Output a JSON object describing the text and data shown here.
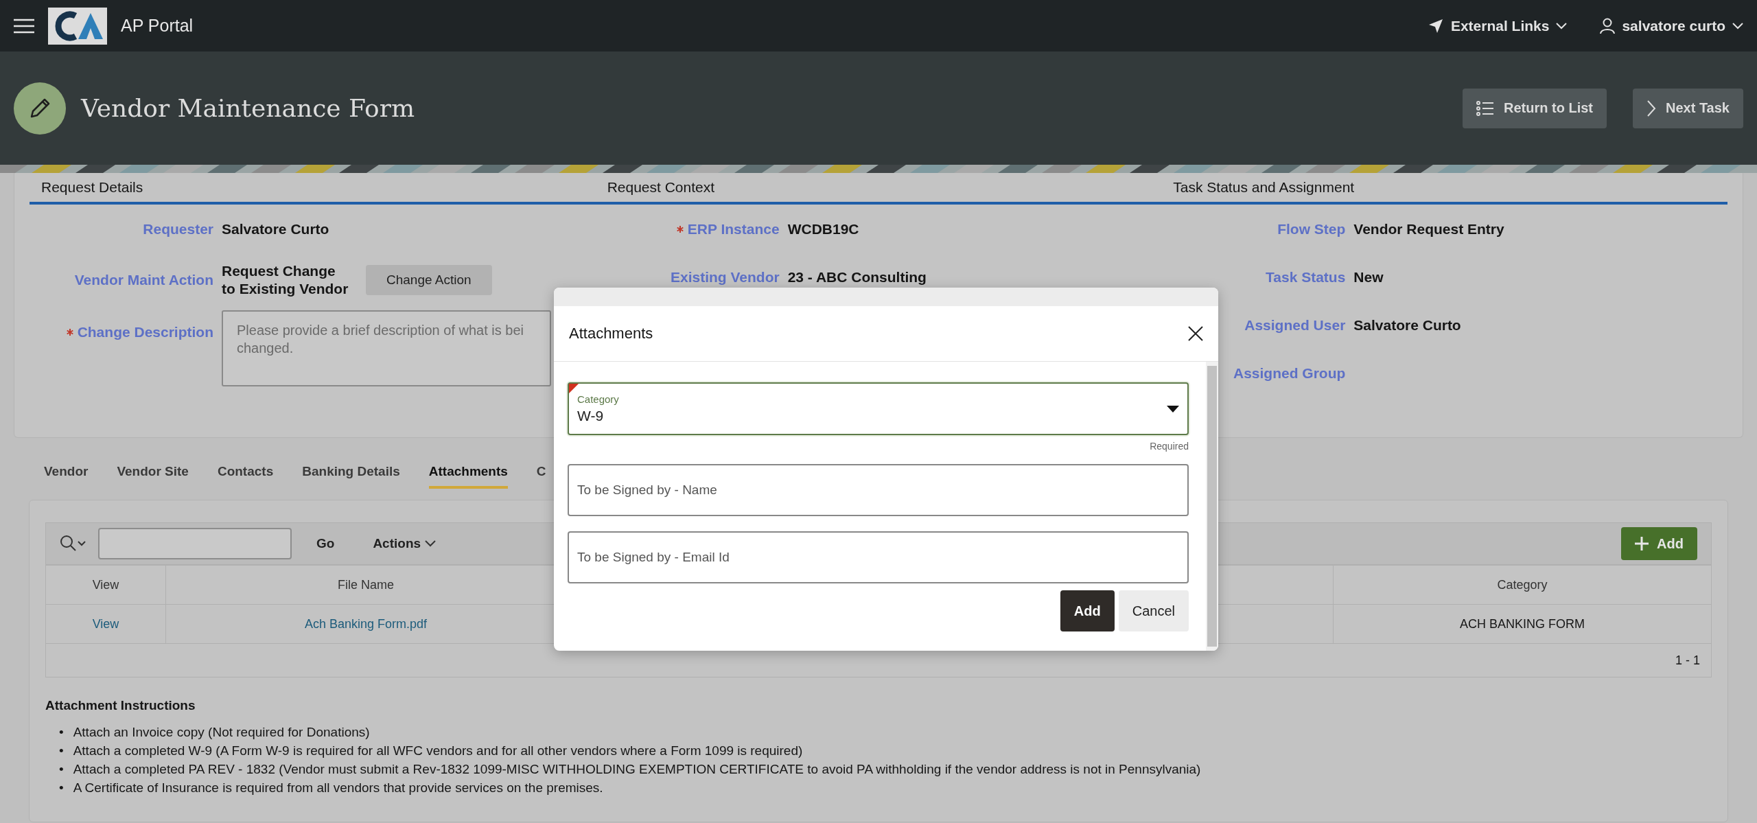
{
  "app_bar": {
    "title": "AP Portal",
    "links": [
      {
        "label": "External Links",
        "kind": "nav"
      },
      {
        "label": "salvatore curto",
        "kind": "user"
      }
    ]
  },
  "page_header": {
    "title": "Vendor Maintenance Form",
    "buttons": [
      {
        "label": "Return to List",
        "kind": "list"
      },
      {
        "label": "Next Task",
        "kind": "next"
      }
    ]
  },
  "regions": [
    {
      "title": "Request Details",
      "fields": [
        {
          "kind": "text",
          "label": "Requester",
          "value": "Salvatore Curto",
          "required": false
        },
        {
          "kind": "action",
          "label": "Vendor Maint Action",
          "value": "Request Change to Existing Vendor",
          "button": "Change Action",
          "required": false
        },
        {
          "kind": "textarea",
          "label": "Change Description",
          "placeholder": "Please provide a brief description of what is bei\nchanged.",
          "required": true
        }
      ]
    },
    {
      "title": "Request Context",
      "fields": [
        {
          "kind": "text",
          "label": "ERP Instance",
          "value": "WCDB19C",
          "required": true
        },
        {
          "kind": "text",
          "label": "Existing Vendor",
          "value": "23 - ABC Consulting",
          "required": false
        }
      ]
    },
    {
      "title": "Task Status and Assignment",
      "fields": [
        {
          "kind": "text",
          "label": "Flow Step",
          "value": "Vendor Request Entry",
          "required": false
        },
        {
          "kind": "text",
          "label": "Task Status",
          "value": "New",
          "required": false
        },
        {
          "kind": "text",
          "label": "Assigned User",
          "value": "Salvatore Curto",
          "required": false
        },
        {
          "kind": "text",
          "label": "Assigned Group",
          "required": false
        }
      ]
    }
  ],
  "tabs": [
    {
      "label": "Vendor",
      "selected": false
    },
    {
      "label": "Vendor Site",
      "selected": false
    },
    {
      "label": "Contacts",
      "selected": false
    },
    {
      "label": "Banking Details",
      "selected": false
    },
    {
      "label": "Attachments",
      "selected": true
    },
    {
      "label": "C",
      "selected": false
    }
  ],
  "toolbar": {
    "go": "Go",
    "actions": "Actions",
    "add": "Add"
  },
  "table": {
    "columns": [
      "View",
      "File Name",
      "Category"
    ],
    "rows": [
      [
        "View",
        "Ach Banking Form.pdf",
        "ACH BANKING FORM"
      ]
    ],
    "pagination": "1 - 1"
  },
  "instructions": {
    "title": "Attachment Instructions",
    "items": [
      {
        "bullet": "•",
        "text": "Attach an Invoice copy (Not required for Donations)"
      },
      {
        "bullet": "•",
        "text": "Attach a completed W-9 (A Form W-9 is required for all WFC vendors and for all other vendors where a Form 1099 is required)"
      },
      {
        "bullet": "•",
        "text": "Attach a completed PA REV - 1832 (Vendor must submit a Rev-1832 1099-MISC WITHHOLDING EXEMPTION CERTIFICATE to avoid PA withholding if the vendor address is not in Pennsylvania)"
      },
      {
        "bullet": "•",
        "text": "A Certificate of Insurance is required from all vendors that provide services on the premises."
      }
    ]
  },
  "dialog": {
    "title": "Attachments",
    "fields": [
      {
        "kind": "select",
        "label": "Category",
        "value": "W-9",
        "required": true,
        "hint": "Required"
      },
      {
        "kind": "text",
        "placeholder": "To be Signed by - Name"
      },
      {
        "kind": "text",
        "placeholder": "To be Signed by - Email Id"
      }
    ],
    "buttons": [
      {
        "label": "Add",
        "kind": "primary"
      },
      {
        "label": "Cancel",
        "kind": "secondary"
      }
    ]
  }
}
